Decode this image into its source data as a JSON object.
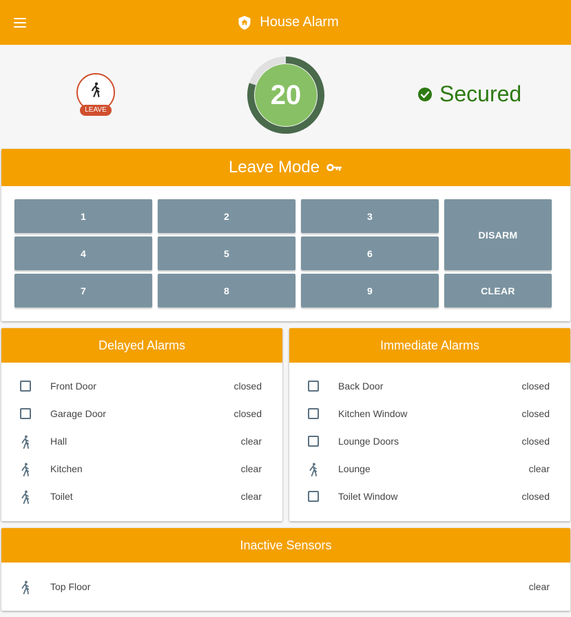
{
  "header": {
    "title": "House Alarm",
    "menu_icon": "menu-icon",
    "logo_icon": "shield-home-icon"
  },
  "status": {
    "mode_badge": {
      "label": "LEAVE",
      "icon": "walking-person-icon"
    },
    "countdown": {
      "value": "20",
      "fraction_remaining": 0.8
    },
    "state": {
      "text": "Secured",
      "icon": "check-circle-icon"
    }
  },
  "leave_panel": {
    "title": "Leave Mode",
    "title_icon": "key-icon",
    "keys": [
      "1",
      "2",
      "3",
      "4",
      "5",
      "6",
      "7",
      "8",
      "9"
    ],
    "disarm_label": "DISARM",
    "clear_label": "CLEAR"
  },
  "delayed": {
    "title": "Delayed Alarms",
    "rows": [
      {
        "name": "Front Door",
        "state": "closed",
        "icon": "checkbox-icon"
      },
      {
        "name": "Garage Door",
        "state": "closed",
        "icon": "checkbox-icon"
      },
      {
        "name": "Hall",
        "state": "clear",
        "icon": "walking-person-icon"
      },
      {
        "name": "Kitchen",
        "state": "clear",
        "icon": "walking-person-icon"
      },
      {
        "name": "Toilet",
        "state": "clear",
        "icon": "walking-person-icon"
      }
    ]
  },
  "immediate": {
    "title": "Immediate Alarms",
    "rows": [
      {
        "name": "Back Door",
        "state": "closed",
        "icon": "checkbox-icon"
      },
      {
        "name": "Kitchen Window",
        "state": "closed",
        "icon": "checkbox-icon"
      },
      {
        "name": "Lounge Doors",
        "state": "closed",
        "icon": "checkbox-icon"
      },
      {
        "name": "Lounge",
        "state": "clear",
        "icon": "walking-person-icon"
      },
      {
        "name": "Toilet Window",
        "state": "closed",
        "icon": "checkbox-icon"
      }
    ]
  },
  "inactive": {
    "title": "Inactive Sensors",
    "rows": [
      {
        "name": "Top Floor",
        "state": "clear",
        "icon": "walking-person-icon"
      }
    ]
  },
  "colors": {
    "accent": "#f3a000",
    "keypad": "#7b93a0",
    "secured": "#2d7a12",
    "badge": "#d0502e",
    "countdown_fill": "#88c065",
    "countdown_ring": "#4a6a4c"
  }
}
